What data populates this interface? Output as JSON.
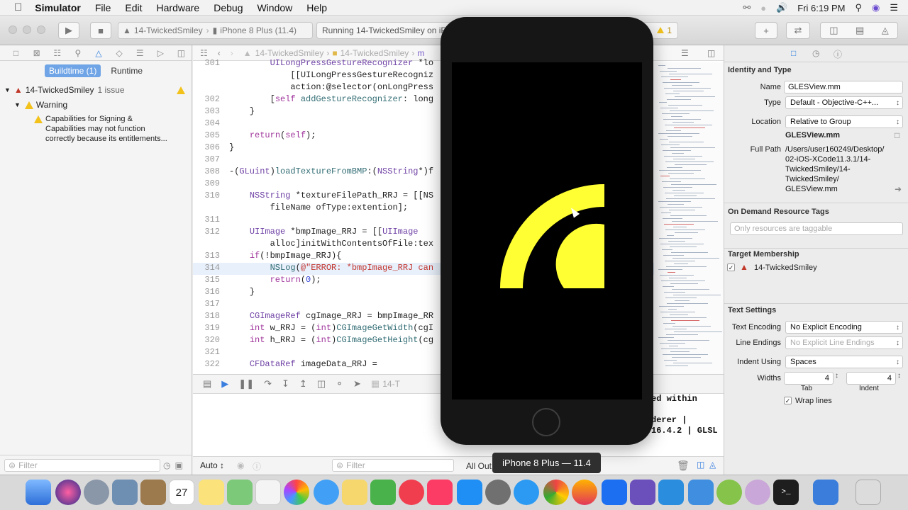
{
  "menubar": {
    "apple_icon": "apple-icon",
    "app_name": "Simulator",
    "items": [
      "File",
      "Edit",
      "Hardware",
      "Debug",
      "Window",
      "Help"
    ],
    "clock": "Fri 6:19 PM"
  },
  "toolbar": {
    "scheme_target": "14-TwickedSmiley",
    "scheme_device": "iPhone 8 Plus (11.4)",
    "activity_text": "Running 14-TwickedSmiley on iPhone 8 Plus",
    "warning_count": "1"
  },
  "navigator": {
    "tabs": [
      "Buildtime (1)",
      "Runtime"
    ],
    "project": "14-TwickedSmiley",
    "issue_count": "1 issue",
    "group": "Warning",
    "issue_lines": [
      "Capabilities for Signing &",
      "Capabilities may not function",
      "correctly because its entitlements..."
    ],
    "filter_placeholder": "Filter"
  },
  "editor": {
    "breadcrumb": [
      "14-TwickedSmiley",
      "14-TwickedSmiley",
      "m"
    ],
    "lines": [
      {
        "n": "301",
        "t": "        UILongPressGestureRecognizer *lo"
      },
      {
        "n": "",
        "t": "            [[UILongPressGestureRecogniz"
      },
      {
        "n": "",
        "t": "            action:@selector(onLongPress"
      },
      {
        "n": "302",
        "t": "        [self addGestureRecognizer: long"
      },
      {
        "n": "303",
        "t": "    }"
      },
      {
        "n": "304",
        "t": ""
      },
      {
        "n": "305",
        "t": "    return(self);"
      },
      {
        "n": "306",
        "t": "}"
      },
      {
        "n": "307",
        "t": ""
      },
      {
        "n": "308",
        "t": "-(GLuint)loadTextureFromBMP:(NSString*)f"
      },
      {
        "n": "309",
        "t": ""
      },
      {
        "n": "310",
        "t": "    NSString *textureFilePath_RRJ = [[NS"
      },
      {
        "n": "",
        "t": "        fileName ofType:extention];"
      },
      {
        "n": "311",
        "t": ""
      },
      {
        "n": "312",
        "t": "    UIImage *bmpImage_RRJ = [[UIImage"
      },
      {
        "n": "",
        "t": "        alloc]initWithContentsOfFile:tex"
      },
      {
        "n": "313",
        "t": "    if(!bmpImage_RRJ){"
      },
      {
        "n": "314",
        "t": "        NSLog(@\"ERROR: *bmpImage_RRJ can"
      },
      {
        "n": "315",
        "t": "        return(0);"
      },
      {
        "n": "316",
        "t": "    }"
      },
      {
        "n": "317",
        "t": ""
      },
      {
        "n": "318",
        "t": "    CGImageRef cgImage_RRJ = bmpImage_RR"
      },
      {
        "n": "319",
        "t": "    int w_RRJ = (int)CGImageGetWidth(cgI"
      },
      {
        "n": "320",
        "t": "    int h_RRJ = (int)CGImageGetHeight(cg"
      },
      {
        "n": "321",
        "t": ""
      },
      {
        "n": "322",
        "t": "    CFDataRef imageData_RRJ ="
      }
    ],
    "highlight_line": "314"
  },
  "debug": {
    "target_label": "14-T"
  },
  "console": {
    "output": "ed within\n\nderer |\n16.4.2 | GLSL",
    "scope": "Auto",
    "filter_placeholder": "Filter",
    "right_label": "All Out"
  },
  "inspector": {
    "identity_header": "Identity and Type",
    "name_label": "Name",
    "name_value": "GLESView.mm",
    "type_label": "Type",
    "type_value": "Default - Objective-C++...",
    "location_label": "Location",
    "location_value": "Relative to Group",
    "location_file": "GLESView.mm",
    "fullpath_label": "Full Path",
    "fullpath_value": [
      "/Users/user160249/Desktop/",
      "02-iOS-XCode11.3.1/14-",
      "TwickedSmiley/14-",
      "TwickedSmiley/",
      "GLESView.mm"
    ],
    "odr_header": "On Demand Resource Tags",
    "odr_placeholder": "Only resources are taggable",
    "target_header": "Target Membership",
    "target_item": "14-TwickedSmiley",
    "text_header": "Text Settings",
    "encoding_label": "Text Encoding",
    "encoding_value": "No Explicit Encoding",
    "endings_label": "Line Endings",
    "endings_value": "No Explicit Line Endings",
    "indent_label": "Indent Using",
    "indent_value": "Spaces",
    "widths_label": "Widths",
    "tab_value": "4",
    "indent_value_num": "4",
    "tab_label": "Tab",
    "indent_label_small": "Indent",
    "wrap_label": "Wrap lines"
  },
  "simulator": {
    "tooltip": "iPhone 8 Plus — 11.4",
    "drawing_color": "#ffff33"
  },
  "colors": {
    "accent": "#6fa4e6",
    "warning": "#f2c21b"
  }
}
